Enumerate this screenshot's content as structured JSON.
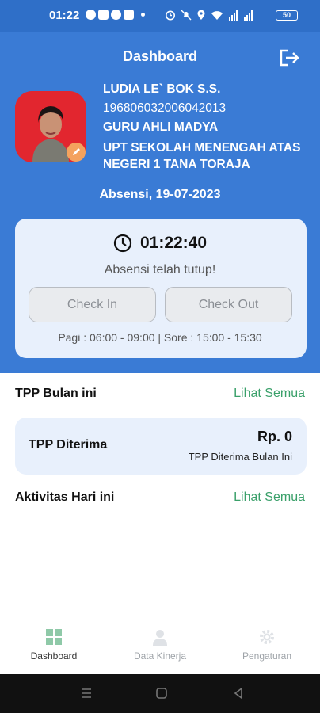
{
  "status_bar": {
    "time": "01:22",
    "battery": "50"
  },
  "header": {
    "title": "Dashboard"
  },
  "profile": {
    "name": "LUDIA LE` BOK S.S.",
    "nip": "196806032006042013",
    "rank": "GURU AHLI MADYA",
    "unit": "UPT SEKOLAH MENENGAH ATAS NEGERI 1 TANA TORAJA"
  },
  "attendance": {
    "date_label": "Absensi, 19-07-2023",
    "clock": "01:22:40",
    "status": "Absensi telah tutup!",
    "check_in_label": "Check In",
    "check_out_label": "Check Out",
    "schedule": "Pagi : 06:00 - 09:00  |  Sore : 15:00 - 15:30"
  },
  "tpp": {
    "section_title": "TPP Bulan ini",
    "see_all": "Lihat Semua",
    "card_label": "TPP Diterima",
    "amount": "Rp. 0",
    "amount_caption": "TPP Diterima Bulan Ini"
  },
  "activities": {
    "section_title": "Aktivitas Hari ini",
    "see_all": "Lihat Semua"
  },
  "bottom_nav": {
    "items": [
      {
        "label": "Dashboard",
        "icon": "grid-icon",
        "active": true
      },
      {
        "label": "Data Kinerja",
        "icon": "user-icon",
        "active": false
      },
      {
        "label": "Pengaturan",
        "icon": "gear-icon",
        "active": false
      }
    ]
  },
  "colors": {
    "primary": "#3a7bd5",
    "status_bar": "#2f6fc8",
    "card": "#e8f0fc",
    "link": "#3aa06a",
    "avatar_bg": "#e2262f"
  }
}
